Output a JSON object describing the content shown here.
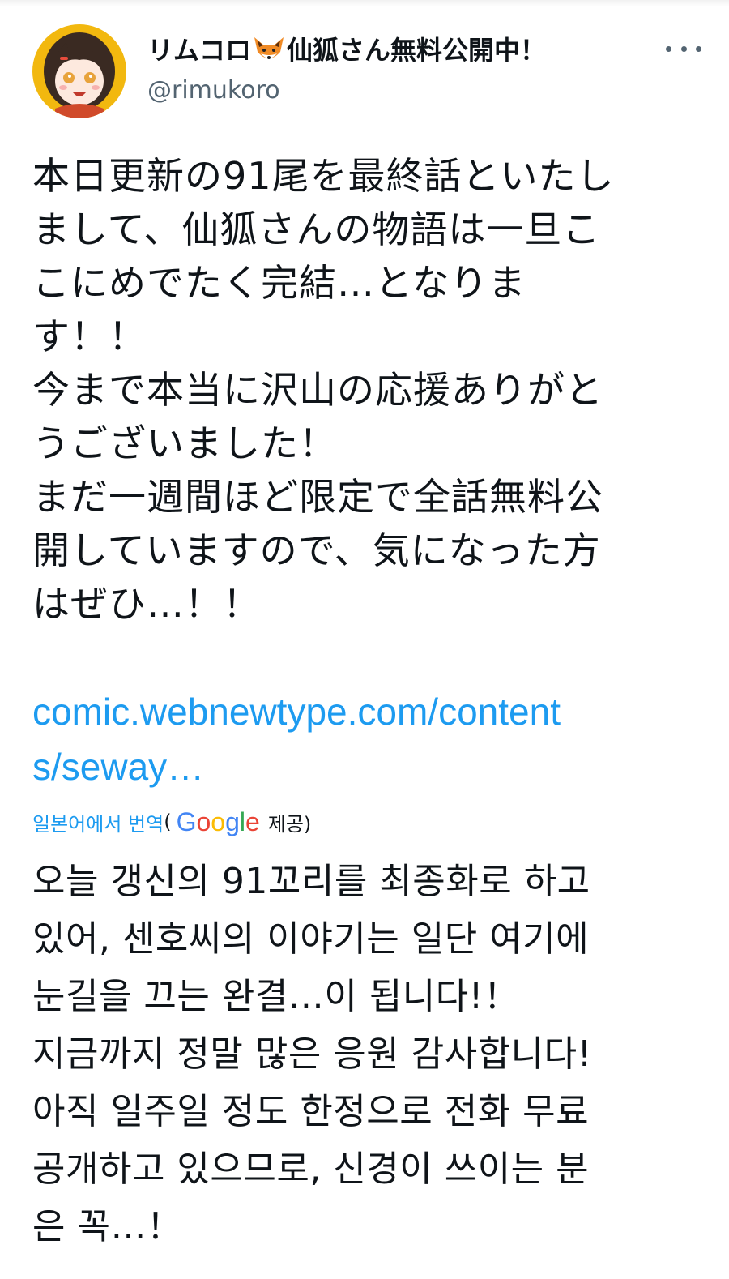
{
  "tweet": {
    "author": {
      "display_name_prefix": "リムコロ",
      "display_name_suffix": "仙狐さん無料公開中！",
      "handle": "@rimukoro",
      "name_emoji": "fox-face-icon"
    },
    "text_lines": [
      "本日更新の91尾を最終話といたし",
      "まして、仙狐さんの物語は一旦こ",
      "こにめでたく完結…となりま",
      "す！！",
      "今まで本当に沢山の応援ありがと",
      "うございました！",
      "まだ一週間ほど限定で全話無料公",
      "開していますので、気になった方",
      "はぜひ…！！"
    ],
    "link_lines": [
      "comic.webnewtype.com/content",
      "s/seway…"
    ],
    "translation": {
      "label": "일본어에서 번역",
      "open_paren": "(",
      "provider": "Google",
      "provided_label": "제공)",
      "lines": [
        "오늘 갱신의 91꼬리를 최종화로 하고",
        "있어, 센호씨의 이야기는 일단 여기에",
        "눈길을 끄는 완결…이 됩니다!！",
        "지금까지 정말 많은 응원 감사합니다!",
        "아직 일주일 정도 한정으로 전화 무료",
        "공개하고 있으므로, 신경이 쓰이는 분",
        "은 꼭…！"
      ]
    }
  },
  "colors": {
    "link": "#1d9bf0",
    "text": "#0f1419",
    "secondary": "#536471"
  }
}
